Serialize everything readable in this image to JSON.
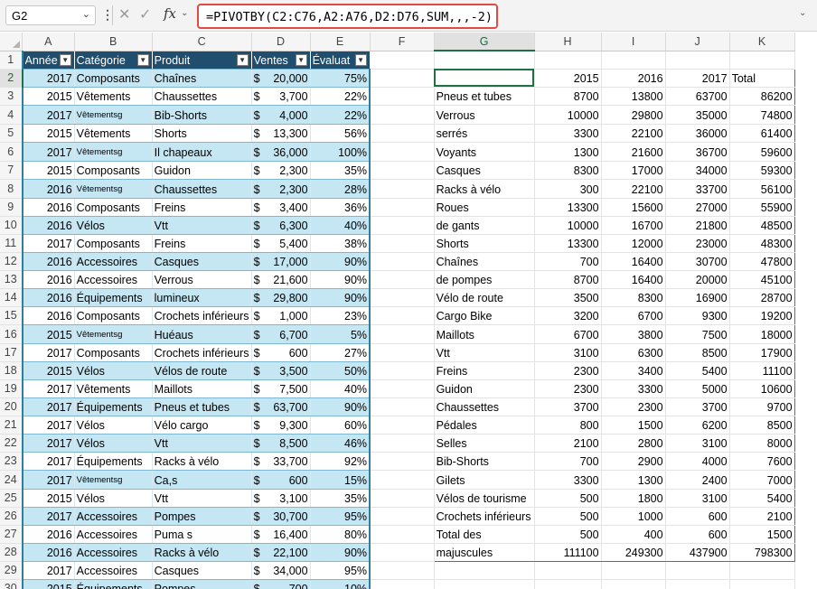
{
  "formula_bar": {
    "name_box": "G2",
    "formula": "=PIVOTBY(C2:C76,A2:A76,D2:D76,SUM,,,-2)",
    "icons": {
      "cancel": "cross-icon",
      "enter": "check-icon",
      "function": "fx-icon",
      "more": "vertical-dots-icon",
      "dropdown": "chevron-down-icon"
    }
  },
  "columns": [
    "A",
    "B",
    "C",
    "D",
    "E",
    "F",
    "G",
    "H",
    "I",
    "J",
    "K"
  ],
  "rows": [
    "1",
    "2",
    "3",
    "4",
    "5",
    "6",
    "7",
    "8",
    "9",
    "10",
    "11",
    "12",
    "13",
    "14",
    "15",
    "16",
    "17",
    "18",
    "19",
    "20",
    "21",
    "22",
    "23",
    "24",
    "25",
    "26",
    "27",
    "28",
    "29",
    "30"
  ],
  "table": {
    "headers": [
      "Année",
      "Catégorie",
      "Produit",
      "Ventes",
      "Évaluat"
    ],
    "rows": [
      [
        "2017",
        "Composants",
        "Chaînes",
        "20,000",
        "75%"
      ],
      [
        "2015",
        "Vêtements",
        "Chaussettes",
        "3,700",
        "22%"
      ],
      [
        "2017",
        "Vêtementsg",
        "Bib-Shorts",
        "4,000",
        "22%"
      ],
      [
        "2015",
        "Vêtements",
        "Shorts",
        "13,300",
        "56%"
      ],
      [
        "2017",
        "Vêtementsg",
        "Il chapeaux",
        "36,000",
        "100%"
      ],
      [
        "2015",
        "Composants",
        "Guidon",
        "2,300",
        "35%"
      ],
      [
        "2016",
        "Vêtementsg",
        "Chaussettes",
        "2,300",
        "28%"
      ],
      [
        "2016",
        "Composants",
        "Freins",
        "3,400",
        "36%"
      ],
      [
        "2016",
        "Vélos",
        "Vtt",
        "6,300",
        "40%"
      ],
      [
        "2017",
        "Composants",
        "Freins",
        "5,400",
        "38%"
      ],
      [
        "2016",
        "Accessoires",
        "Casques",
        "17,000",
        "90%"
      ],
      [
        "2016",
        "Accessoires",
        "Verrous",
        "21,600",
        "90%"
      ],
      [
        "2016",
        "Équipements",
        "lumineux",
        "29,800",
        "90%"
      ],
      [
        "2016",
        "Composants",
        "Crochets inférieurs",
        "1,000",
        "23%"
      ],
      [
        "2015",
        "Vêtementsg",
        "Huéaus",
        "6,700",
        "5%"
      ],
      [
        "2017",
        "Composants",
        "Crochets inférieurs",
        "600",
        "27%"
      ],
      [
        "2015",
        "Vélos",
        "Vélos de route",
        "3,500",
        "50%"
      ],
      [
        "2017",
        "Vêtements",
        "Maillots",
        "7,500",
        "40%"
      ],
      [
        "2017",
        "Équipements",
        "Pneus et tubes",
        "63,700",
        "90%"
      ],
      [
        "2017",
        "Vélos",
        "Vélo cargo",
        "9,300",
        "60%"
      ],
      [
        "2017",
        "Vélos",
        "Vtt",
        "8,500",
        "46%"
      ],
      [
        "2017",
        "Équipements",
        "Racks à vélo",
        "33,700",
        "92%"
      ],
      [
        "2017",
        "Vêtementsg",
        "Ca,s",
        "600",
        "15%"
      ],
      [
        "2015",
        "Vélos",
        "Vtt",
        "3,100",
        "35%"
      ],
      [
        "2017",
        "Accessoires",
        "Pompes",
        "30,700",
        "95%"
      ],
      [
        "2016",
        "Accessoires",
        "Puma s",
        "16,400",
        "80%"
      ],
      [
        "2016",
        "Accessoires",
        "Racks à vélo",
        "22,100",
        "90%"
      ],
      [
        "2017",
        "Accessoires",
        "Casques",
        "34,000",
        "95%"
      ],
      [
        "2015",
        "Équipements",
        "Pompes",
        "700",
        "10%"
      ]
    ],
    "currency_symbol": "$"
  },
  "pivot": {
    "headers": [
      "2015",
      "2016",
      "2017",
      "Total"
    ],
    "rows": [
      [
        "Pneus et tubes",
        "8700",
        "13800",
        "63700",
        "86200"
      ],
      [
        "Verrous",
        "10000",
        "29800",
        "35000",
        "74800"
      ],
      [
        "serrés",
        "3300",
        "22100",
        "36000",
        "61400"
      ],
      [
        "Voyants",
        "1300",
        "21600",
        "36700",
        "59600"
      ],
      [
        "Casques",
        "8300",
        "17000",
        "34000",
        "59300"
      ],
      [
        "Racks à vélo",
        "300",
        "22100",
        "33700",
        "56100"
      ],
      [
        "Roues",
        "13300",
        "15600",
        "27000",
        "55900"
      ],
      [
        "de gants",
        "10000",
        "16700",
        "21800",
        "48500"
      ],
      [
        "Shorts",
        "13300",
        "12000",
        "23000",
        "48300"
      ],
      [
        "Chaînes",
        "700",
        "16400",
        "30700",
        "47800"
      ],
      [
        "de pompes",
        "8700",
        "16400",
        "20000",
        "45100"
      ],
      [
        "Vélo de route",
        "3500",
        "8300",
        "16900",
        "28700"
      ],
      [
        "Cargo Bike",
        "3200",
        "6700",
        "9300",
        "19200"
      ],
      [
        "Maillots",
        "6700",
        "3800",
        "7500",
        "18000"
      ],
      [
        "Vtt",
        "3100",
        "6300",
        "8500",
        "17900"
      ],
      [
        "Freins",
        "2300",
        "3400",
        "5400",
        "11100"
      ],
      [
        "Guidon",
        "2300",
        "3300",
        "5000",
        "10600"
      ],
      [
        "Chaussettes",
        "3700",
        "2300",
        "3700",
        "9700"
      ],
      [
        "Pédales",
        "800",
        "1500",
        "6200",
        "8500"
      ],
      [
        "Selles",
        "2100",
        "2800",
        "3100",
        "8000"
      ],
      [
        "Bib-Shorts",
        "700",
        "2900",
        "4000",
        "7600"
      ],
      [
        "Gilets",
        "3300",
        "1300",
        "2400",
        "7000"
      ],
      [
        "Vélos de tourisme",
        "500",
        "1800",
        "3100",
        "5400"
      ],
      [
        "Crochets inférieurs",
        "500",
        "1000",
        "600",
        "2100"
      ],
      [
        "Total des",
        "500",
        "400",
        "600",
        "1500"
      ],
      [
        "majuscules",
        "111100",
        "249300",
        "437900",
        "798300"
      ]
    ]
  }
}
